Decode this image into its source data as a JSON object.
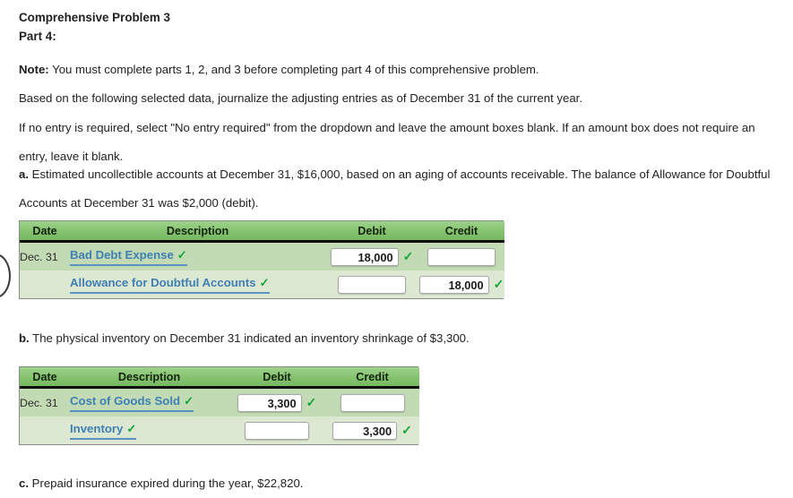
{
  "document": {
    "heading_line1": "Comprehensive Problem 3",
    "heading_line2": "Part 4:",
    "note_label": "Note:",
    "note_text": " You must complete parts 1, 2, and 3 before completing part 4 of this comprehensive problem.",
    "based_on_text": "Based on the following selected data, journalize the adjusting entries as of December 31 of the current year.",
    "if_no_entry_text": "If no entry is required, select \"No entry required\" from the dropdown and leave the amount boxes blank. If an amount box does not require an entry, leave it blank.",
    "item_a_label": "a.",
    "item_a_text": " Estimated uncollectible accounts at December 31, $16,000, based on an aging of accounts receivable. The balance of Allowance for Doubtful Accounts at December 31 was $2,000 (debit).",
    "item_b_label": "b.",
    "item_b_text": " The physical inventory on December 31 indicated an inventory shrinkage of $3,300.",
    "item_c_label": "c.",
    "item_c_text": " Prepaid insurance expired during the year, $22,820."
  },
  "journal_1": {
    "columns": {
      "date": "Date",
      "description": "Description",
      "debit": "Debit",
      "credit": "Credit"
    },
    "rows": [
      {
        "date": "Dec. 31",
        "account": "Bad Debt Expense",
        "account_correct": "✓",
        "debit_value": "18,000",
        "debit_correct": "✓",
        "credit_value": ""
      },
      {
        "date": "",
        "account": "Allowance for Doubtful Accounts",
        "account_correct": "✓",
        "debit_value": "",
        "credit_value": "18,000",
        "credit_correct": "✓"
      }
    ]
  },
  "journal_2": {
    "columns": {
      "date": "Date",
      "description": "Description",
      "debit": "Debit",
      "credit": "Credit"
    },
    "rows": [
      {
        "date": "Dec. 31",
        "account": "Cost of Goods Sold",
        "account_correct": "✓",
        "debit_value": "3,300",
        "debit_correct": "✓",
        "credit_value": ""
      },
      {
        "date": "",
        "account": "Inventory",
        "account_correct": "✓",
        "debit_value": "",
        "credit_value": "3,300",
        "credit_correct": "✓"
      }
    ]
  },
  "colors": {
    "header_green": "#85c26f",
    "row_green_1": "#c3dbb4",
    "row_green_2": "#dde8d2",
    "link_blue": "#3e7fb5",
    "check_green": "#13a538"
  }
}
